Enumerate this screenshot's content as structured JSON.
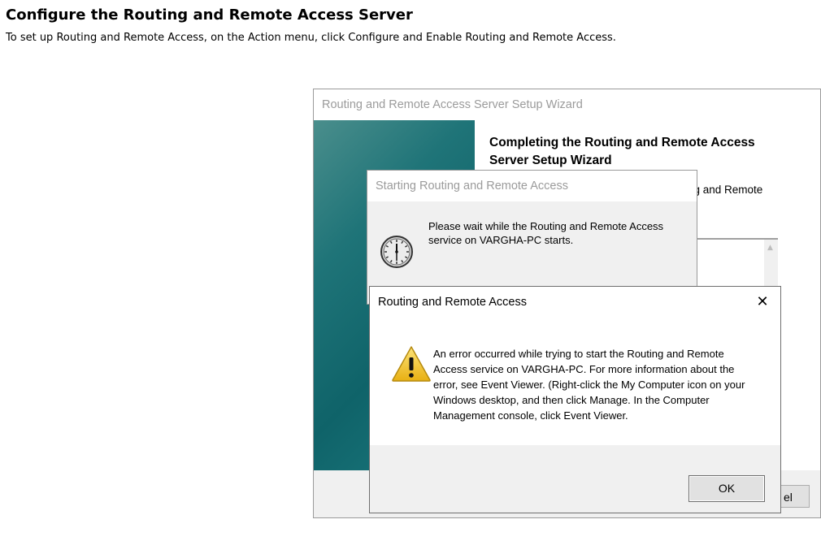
{
  "doc": {
    "title": "Configure the Routing and Remote Access Server",
    "instruction": "To set up Routing and Remote Access, on the Action menu, click Configure and Enable Routing and Remote Access."
  },
  "wizard": {
    "title": "Routing and Remote Access Server Setup Wizard",
    "heading": "Completing the Routing and Remote Access Server Setup Wizard",
    "partial_text": "ng and Remote",
    "cancel_partial": "el"
  },
  "starting_dialog": {
    "title": "Starting Routing and Remote Access",
    "message": "Please wait while the Routing and Remote Access service on VARGHA-PC starts."
  },
  "error_dialog": {
    "title": "Routing and Remote Access",
    "close_glyph": "✕",
    "message": "An error occurred while trying to start the Routing and Remote Access service on VARGHA-PC. For more information about the error, see Event Viewer. (Right-click the My Computer icon on your Windows desktop, and then click Manage. In the Computer Management console, click Event Viewer.",
    "ok_label": "OK",
    "icon": "warning-icon"
  },
  "colors": {
    "wizard_banner": "#0f6369",
    "dialog_bg": "#f0f0f0",
    "warning_yellow": "#f5c518"
  }
}
